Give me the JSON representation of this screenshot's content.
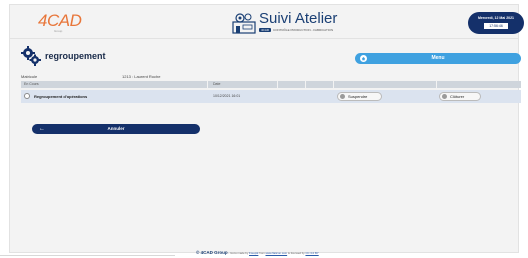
{
  "header": {
    "logo_text": "4CAD",
    "logo_sub": "Group",
    "app_title": "Suivi Atelier",
    "app_tag": "4CAD",
    "app_subtitle": "CONTRÔLE PRODUCTION - FABRICATION",
    "date": "Mercredi, 12 Mai 2021",
    "time": "17:56:46"
  },
  "page": {
    "title": "regroupement",
    "menu_label": "Menu",
    "matricule_label": "Matricule",
    "matricule_value": "1213 : Laurent Roche"
  },
  "grid": {
    "columns": [
      "En Cours",
      "Date"
    ],
    "rows": [
      {
        "label": "Regroupement d'opérations",
        "date": "10/12/2021 16:01",
        "suspend_label": "Suspendre",
        "close_label": "Clôturer"
      }
    ]
  },
  "actions": {
    "cancel_label": "Annuler"
  },
  "footer": {
    "brand": "© 4CAD Group",
    "credit_prefix": " - Icons made by ",
    "credit_author": "Freepik",
    "credit_from": " from ",
    "credit_site": "www.flaticon.com",
    "credit_license": " is licensed by ",
    "credit_license_name": "CC 3.0 BY"
  },
  "colors": {
    "navy": "#14306a",
    "accent_blue": "#3fa1e0",
    "logo_orange": "#e8763a",
    "row_highlight": "#dbe3ef"
  }
}
